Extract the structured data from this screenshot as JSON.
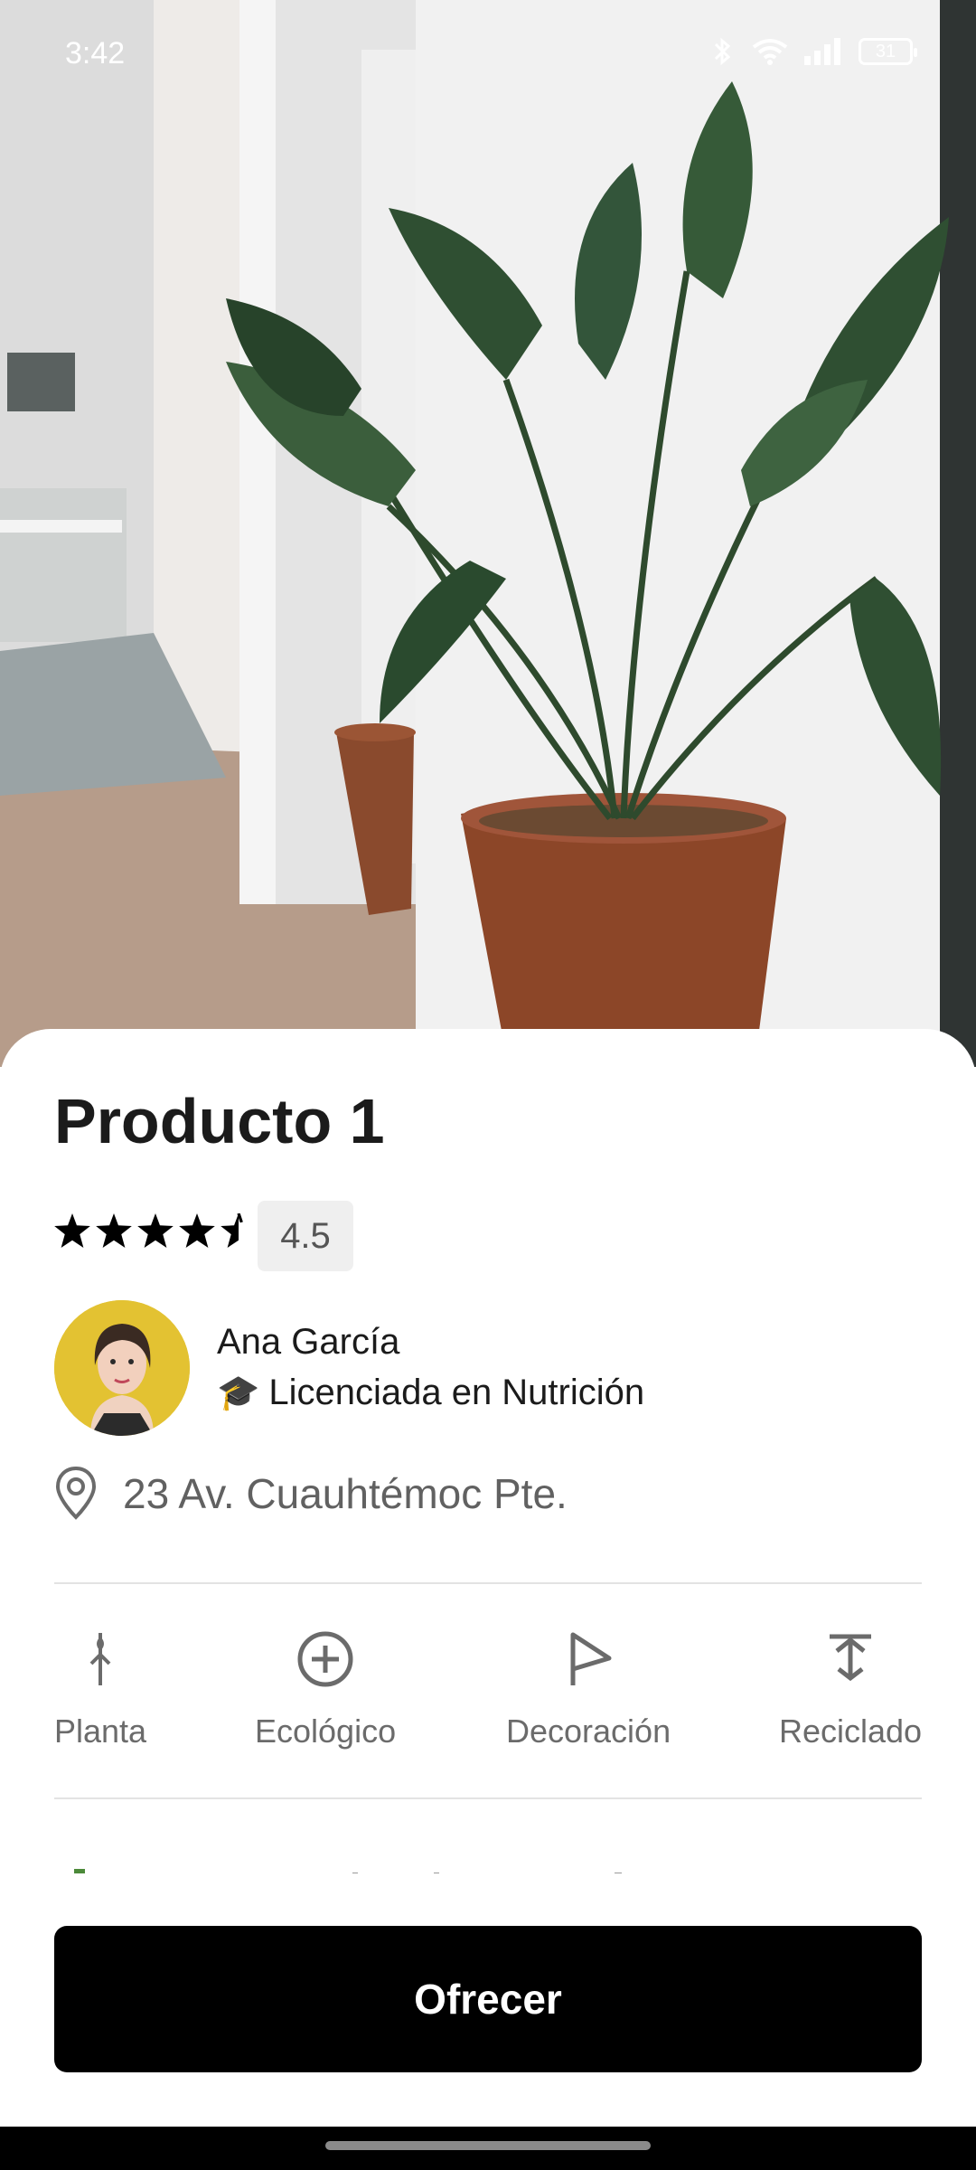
{
  "status_bar": {
    "time": "3:42",
    "battery": "31"
  },
  "hero": {
    "image_icon": "potted-plant-photo"
  },
  "product": {
    "title": "Producto 1",
    "rating": 4.5,
    "rating_label": "4.5"
  },
  "author": {
    "name": "Ana García",
    "title": "Licenciada en Nutrición",
    "title_icon": "graduation-cap-icon"
  },
  "location": {
    "address": "23 Av. Cuauhtémoc Pte.",
    "icon": "location-pin-icon"
  },
  "tags": [
    {
      "label": "Planta",
      "icon": "sprout-icon"
    },
    {
      "label": "Ecológico",
      "icon": "plus-circle-icon"
    },
    {
      "label": "Decoración",
      "icon": "flag-icon"
    },
    {
      "label": "Reciclado",
      "icon": "merge-arrows-icon"
    }
  ],
  "cta": {
    "label": "Ofrecer"
  },
  "colors": {
    "primary": "#000000",
    "text": "#1b1b1b",
    "muted": "#6b6b6b",
    "badge_bg": "#efefef"
  }
}
